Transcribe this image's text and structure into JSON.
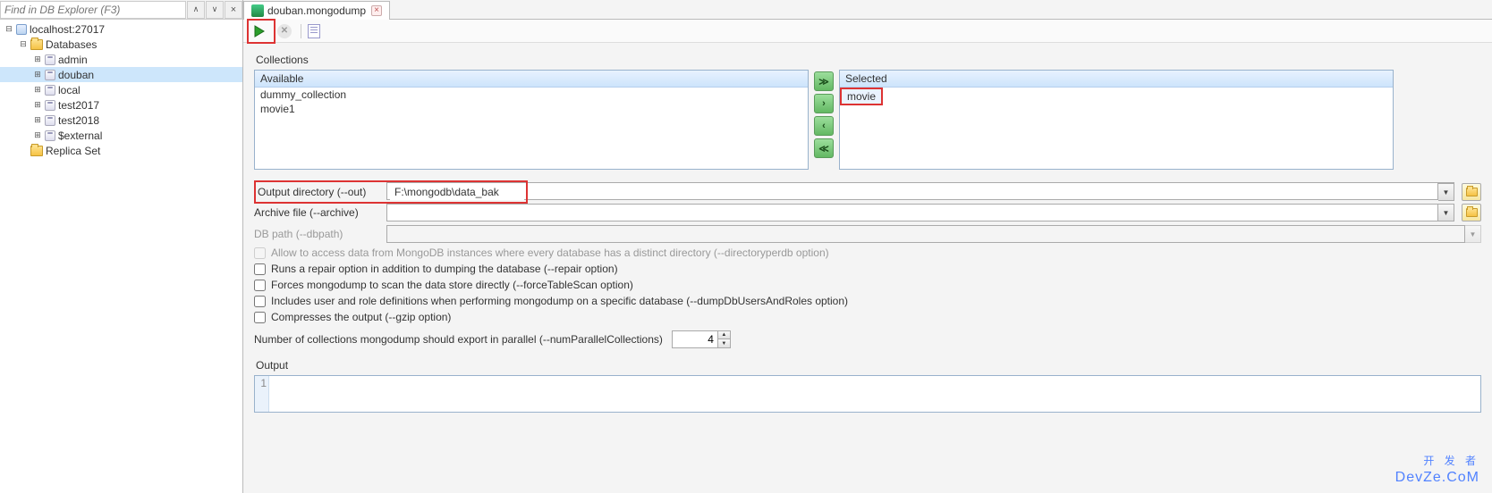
{
  "find": {
    "placeholder": "Find in DB Explorer (F3)"
  },
  "tree": {
    "host": "localhost:27017",
    "databases_label": "Databases",
    "dbs": [
      "admin",
      "douban",
      "local",
      "test2017",
      "test2018",
      "$external"
    ],
    "selected_db": "douban",
    "replica_label": "Replica Set"
  },
  "tab": {
    "title": "douban.mongodump"
  },
  "collections": {
    "section": "Collections",
    "available_header": "Available",
    "selected_header": "Selected",
    "available_items": [
      "dummy_collection",
      "movie1"
    ],
    "selected_items": [
      "movie"
    ]
  },
  "form": {
    "output_dir_label": "Output directory (--out)",
    "output_dir_value": "F:\\mongodb\\data_bak",
    "archive_label": "Archive file (--archive)",
    "archive_value": "",
    "dbpath_label": "DB path (--dbpath)",
    "dbpath_value": ""
  },
  "checks": {
    "dirperdb": "Allow to access data from MongoDB instances where every database has a distinct directory (--directoryperdb option)",
    "repair": "Runs a repair option in addition to dumping the database (--repair option)",
    "forcetable": "Forces mongodump to scan the data store directly (--forceTableScan option)",
    "dumpusers": "Includes user and role definitions when performing mongodump on a specific database (--dumpDbUsersAndRoles option)",
    "gzip": "Compresses the output (--gzip option)"
  },
  "parallel": {
    "label": "Number of collections mongodump should export in parallel (--numParallelCollections)",
    "value": "4"
  },
  "output": {
    "label": "Output",
    "line_no": "1"
  },
  "watermark": {
    "line1": "开 发 者",
    "line2": "DevZe.CoM"
  }
}
